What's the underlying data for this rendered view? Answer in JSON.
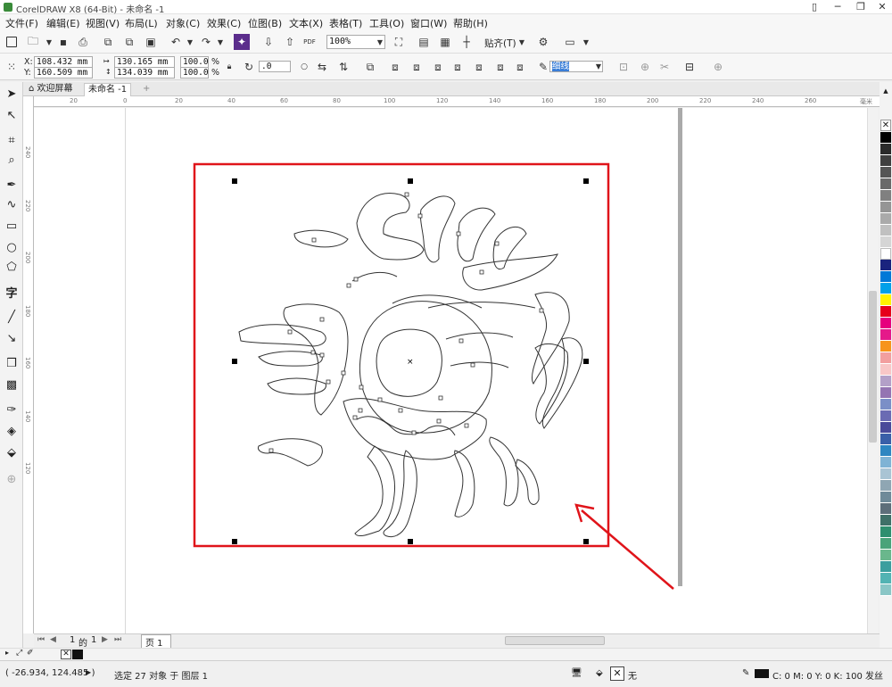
{
  "window": {
    "title": "CorelDRAW X8 (64-Bit) - 未命名 -1",
    "minimize": "─",
    "maximize": "❐",
    "close": "✕"
  },
  "menu": [
    "文件(F)",
    "编辑(E)",
    "视图(V)",
    "布局(L)",
    "对象(C)",
    "效果(C)",
    "位图(B)",
    "文本(X)",
    "表格(T)",
    "工具(O)",
    "窗口(W)",
    "帮助(H)"
  ],
  "toolbar1": {
    "zoom": "100%",
    "snap_label": "贴齐(T)",
    "pdf_label": "PDF"
  },
  "propertybar": {
    "x_label": "X:",
    "x_value": "108.432 mm",
    "y_label": "Y:",
    "y_value": "160.509 mm",
    "w_value": "130.165 mm",
    "h_value": "134.039 mm",
    "scale_w": "100.0",
    "scale_h": "100.0",
    "pct": "%",
    "rotation": ".0",
    "outline_width": "细线"
  },
  "tabs": {
    "welcome": "欢迎屏幕",
    "document": "未命名 -1",
    "add": "+"
  },
  "ruler": {
    "h_ticks": [
      "20",
      "0",
      "20",
      "40",
      "60",
      "80",
      "100",
      "120",
      "140",
      "160",
      "180",
      "200",
      "220",
      "240",
      "260"
    ],
    "h_unit": "毫米",
    "v_ticks": [
      "240",
      "220",
      "200",
      "180",
      "160",
      "140",
      "120"
    ]
  },
  "pages": {
    "current": "1",
    "of": "的",
    "total": "1",
    "page_tab": "页 1"
  },
  "status": {
    "coords": "( -26.934, 124.485 )",
    "selection": "选定 27 对象 于 图层 1",
    "fill_none": "无",
    "outline_info": "C: 0 M: 0 Y: 0 K: 100 发丝"
  },
  "colors": {
    "highlight_box": "#e0141a",
    "arrow": "#e0141a",
    "palette": [
      "#000000",
      "#2b2b2b",
      "#404040",
      "#555555",
      "#6a6a6a",
      "#808080",
      "#959595",
      "#aaaaaa",
      "#c0c0c0",
      "#d5d5d5",
      "#ffffff",
      "#1a237e",
      "#0078d7",
      "#00a0e9",
      "#fff200",
      "#e6001b",
      "#e6007e",
      "#e5198a",
      "#f7941d",
      "#f29f9f",
      "#f8c7c7",
      "#b3a0c8",
      "#9474b2",
      "#7b8fc7",
      "#6b6bb3",
      "#4a4a9a",
      "#3a5fa8",
      "#2e86c1",
      "#7fb3d5",
      "#a9c4d4",
      "#8fa6b3",
      "#6f8a99",
      "#5d6e7a",
      "#3f7068",
      "#2f8f6f",
      "#4aa37a",
      "#6ab78c",
      "#3b9e9e",
      "#52b3b3",
      "#8ac6c6"
    ]
  }
}
